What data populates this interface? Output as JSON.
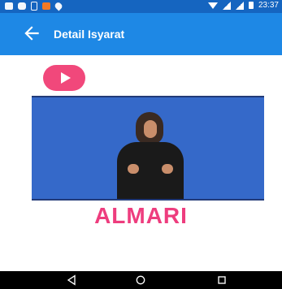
{
  "status_bar": {
    "time": "23:37",
    "icons": [
      "facebook-icon",
      "chat-icon",
      "usb-icon",
      "app-notification-icon",
      "location-icon",
      "wifi-icon",
      "signal-icon",
      "signal-icon",
      "battery-icon"
    ]
  },
  "app_bar": {
    "title": "Detail Isyarat",
    "back_icon": "arrow-left-icon"
  },
  "content": {
    "play_button_icon": "play-icon",
    "video_image": "sign-language-video-frame",
    "sign_word": "ALMARI"
  },
  "navigation_bar": {
    "back_icon": "nav-back-icon",
    "home_icon": "nav-home-icon",
    "recents_icon": "nav-recents-icon"
  },
  "colors": {
    "status_bar_bg": "#1565c0",
    "app_bar_bg": "#1e88e5",
    "accent_pink": "#f1487b",
    "word_pink": "#ee3d7e",
    "video_bg": "#3569c9"
  }
}
